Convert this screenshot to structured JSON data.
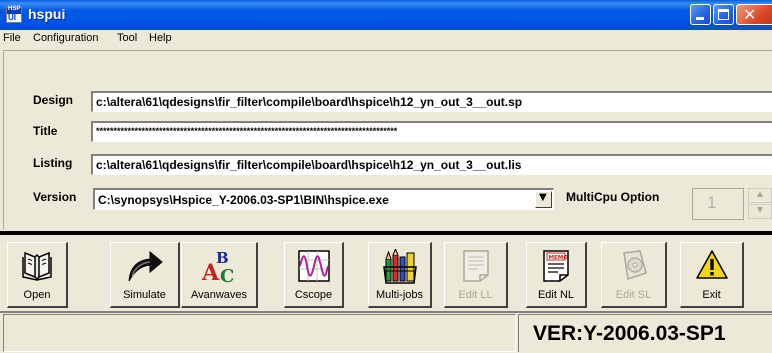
{
  "window": {
    "title": "hspui",
    "icon_name": "hspui-app-icon"
  },
  "menu": [
    {
      "label": "File"
    },
    {
      "label": "Configuration"
    },
    {
      "label": "Tool"
    },
    {
      "label": "Help"
    }
  ],
  "form": {
    "design": {
      "label": "Design",
      "value": "c:\\altera\\61\\qdesigns\\fir_filter\\compile\\board\\hspice\\h12_yn_out_3__out.sp"
    },
    "title": {
      "label": "Title",
      "value": "**************************************************************************************"
    },
    "listing": {
      "label": "Listing",
      "value": "c:\\altera\\61\\qdesigns\\fir_filter\\compile\\board\\hspice\\h12_yn_out_3__out.lis"
    },
    "version": {
      "label": "Version",
      "value": "C:\\synopsys\\Hspice_Y-2006.03-SP1\\BIN\\hspice.exe"
    },
    "multicpu": {
      "label": "MultiCpu Option",
      "value": "1"
    }
  },
  "toolbar": [
    {
      "label": "Open",
      "icon": "open-book-icon",
      "enabled": true
    },
    {
      "label": "Simulate",
      "icon": "curved-arrow-icon",
      "enabled": true
    },
    {
      "label": "Avanwaves",
      "icon": "abc-letters-icon",
      "enabled": true
    },
    {
      "label": "Cscope",
      "icon": "waveform-icon",
      "enabled": true
    },
    {
      "label": "Multi-jobs",
      "icon": "pencil-cup-icon",
      "enabled": true
    },
    {
      "label": "Edit LL",
      "icon": "document-icon",
      "enabled": false
    },
    {
      "label": "Edit NL",
      "icon": "memo-icon",
      "enabled": true
    },
    {
      "label": "Edit SL",
      "icon": "disc-document-icon",
      "enabled": false
    },
    {
      "label": "Exit",
      "icon": "warning-icon",
      "enabled": true
    }
  ],
  "status": {
    "left": "",
    "version": "VER:Y-2006.03-SP1"
  },
  "colors": {
    "titlebar": "#0055e5",
    "face": "#ece9d8",
    "close": "#d9482a"
  }
}
